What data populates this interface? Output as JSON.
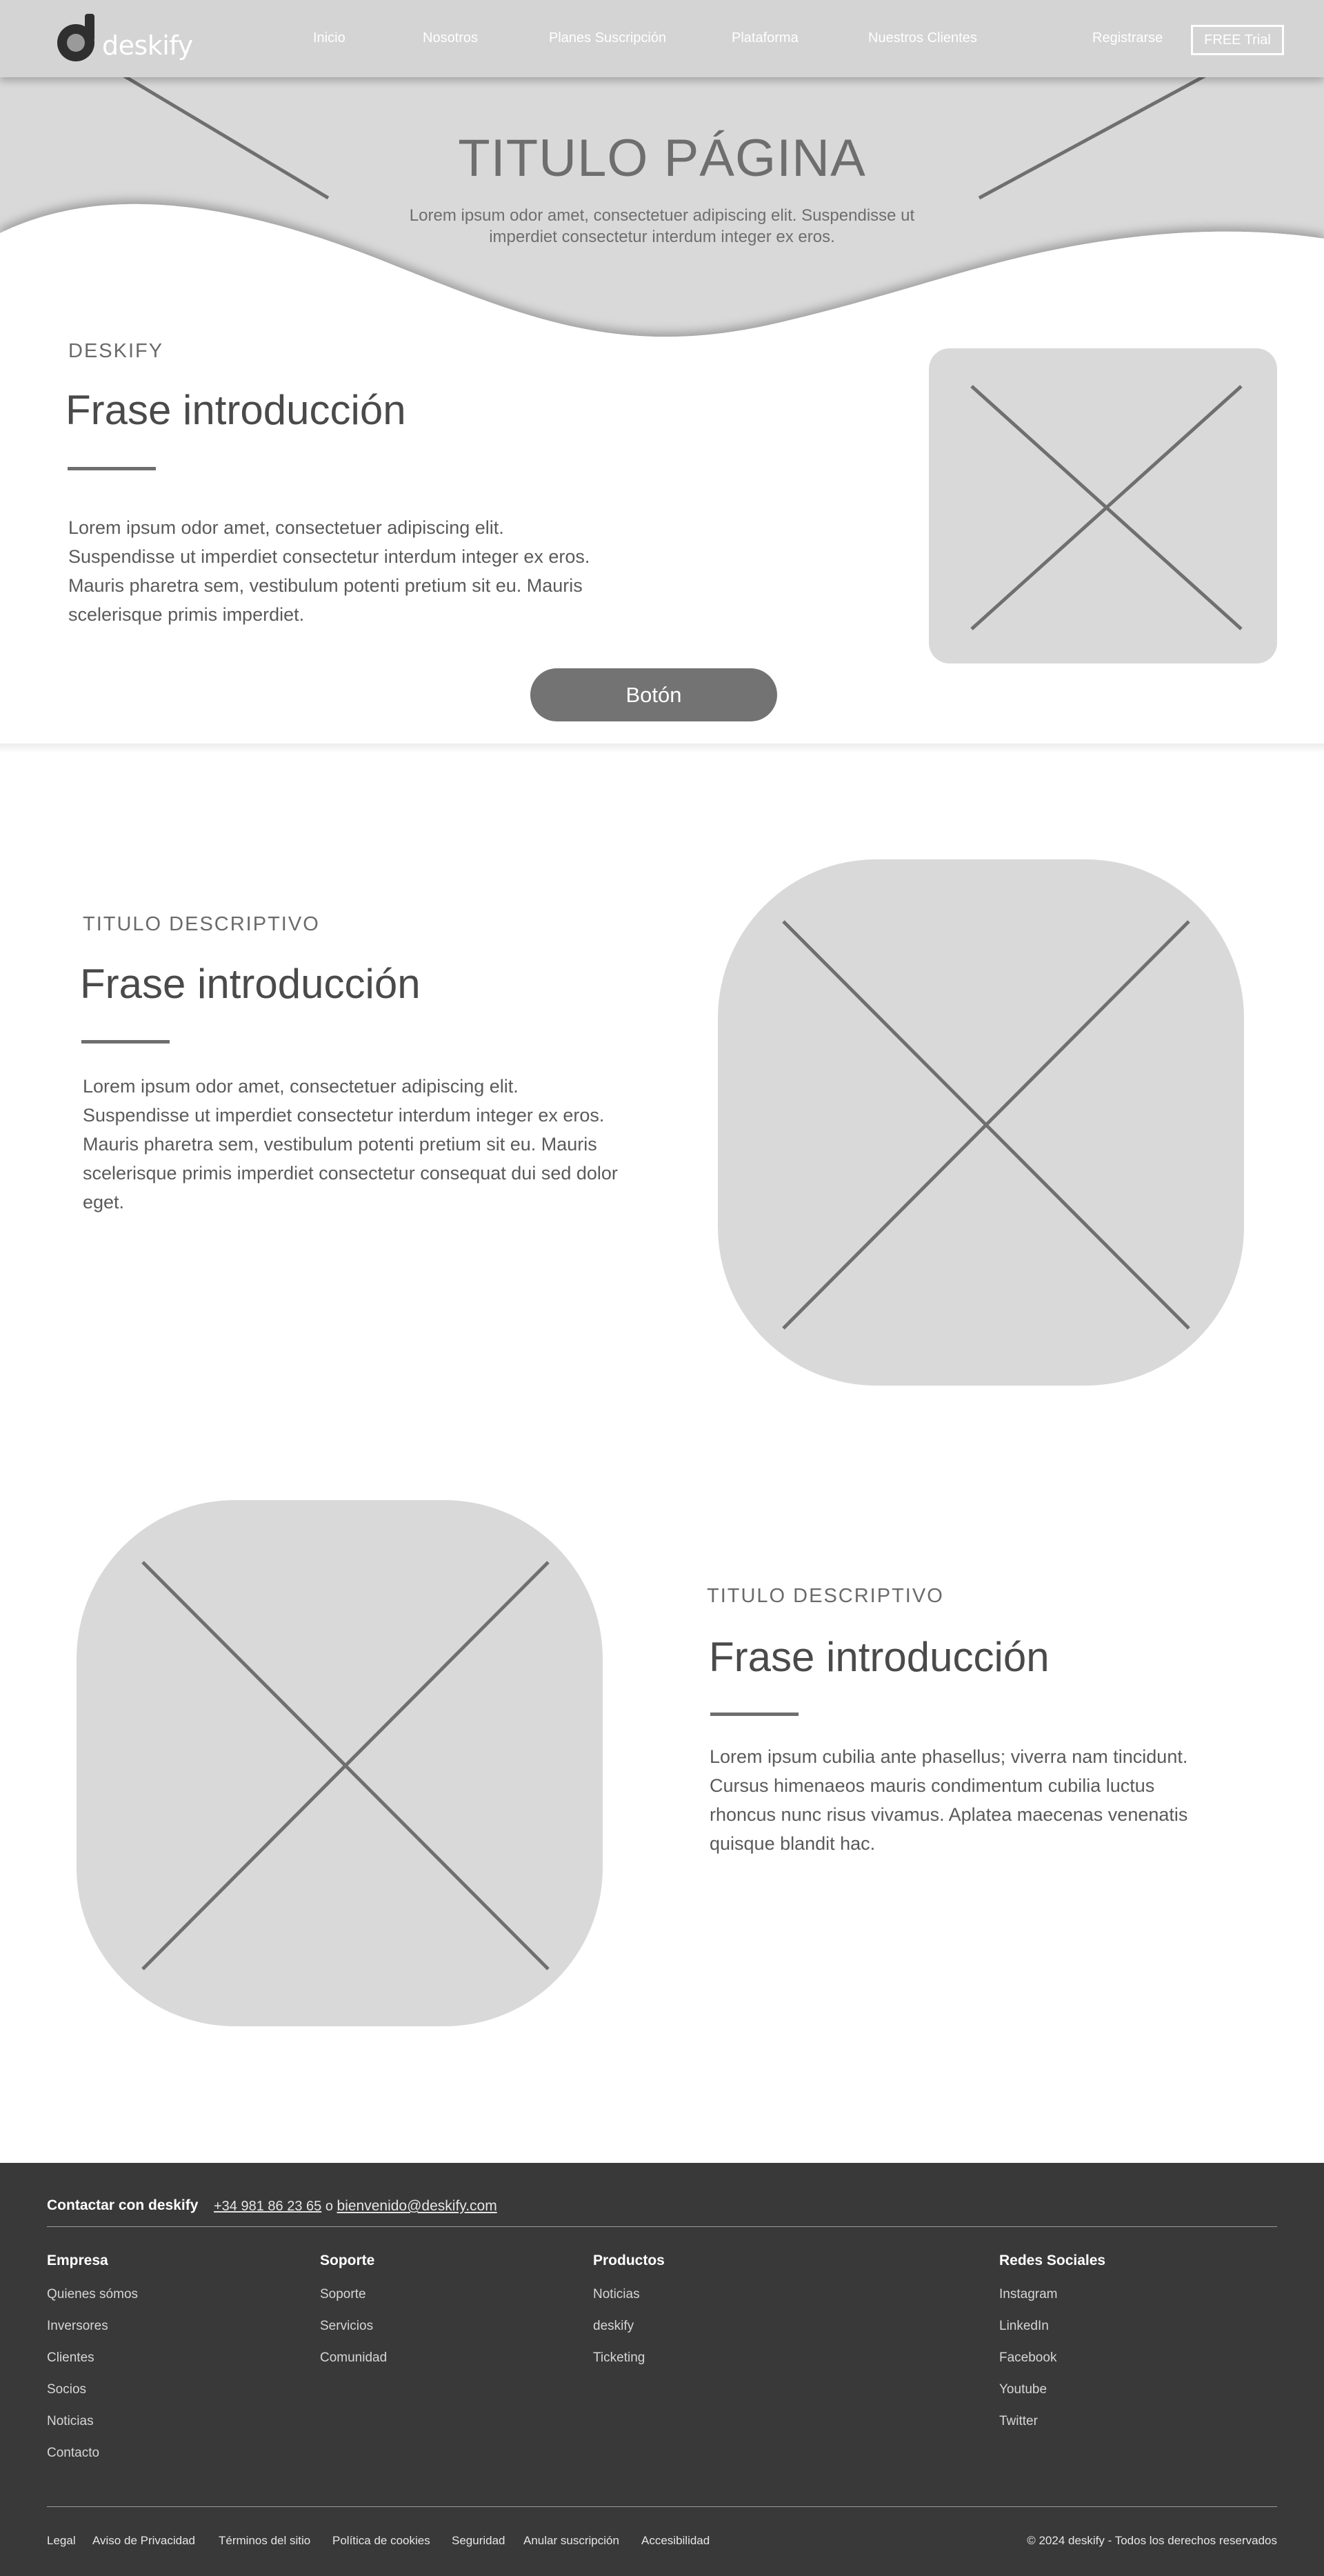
{
  "brand": {
    "name": "deskify"
  },
  "nav": {
    "items": [
      "Inicio",
      "Nosotros",
      "Planes Suscripción",
      "Plataforma",
      "Nuestros Clientes"
    ],
    "register": "Registrarse",
    "trial": "FREE Trial"
  },
  "hero": {
    "title": "TITULO PÁGINA",
    "subtitle": "Lorem ipsum odor amet, consectetuer adipiscing elit. Suspendisse ut imperdiet consectetur interdum integer ex eros."
  },
  "section1": {
    "eyebrow": "DESKIFY",
    "heading": "Frase introducción",
    "body": "Lorem ipsum odor amet, consectetuer adipiscing elit. Suspendisse ut imperdiet consectetur interdum integer ex eros. Mauris pharetra sem, vestibulum potenti pretium sit eu. Mauris scelerisque primis imperdiet.",
    "button": "Botón"
  },
  "section2": {
    "eyebrow": "TITULO DESCRIPTIVO",
    "heading": "Frase introducción",
    "body": "Lorem ipsum odor amet, consectetuer adipiscing elit. Suspendisse ut imperdiet consectetur interdum integer ex eros. Mauris pharetra sem, vestibulum potenti pretium sit eu. Mauris scelerisque primis imperdiet consectetur consequat dui sed dolor eget."
  },
  "section3": {
    "eyebrow": "TITULO DESCRIPTIVO",
    "heading": "Frase introducción",
    "body": "Lorem ipsum cubilia ante phasellus; viverra nam tincidunt. Cursus himenaeos mauris condimentum cubilia luctus rhoncus nunc risus vivamus. Aplatea maecenas venenatis quisque blandit hac."
  },
  "footer": {
    "contact_label": "Contactar con deskify",
    "phone": "+34 981 86 23 65",
    "or": "o",
    "email": "bienvenido@deskify.com",
    "columns": [
      {
        "title": "Empresa",
        "links": [
          "Quienes sómos",
          "Inversores",
          "Clientes",
          "Socios",
          "Noticias",
          "Contacto"
        ]
      },
      {
        "title": "Soporte",
        "links": [
          "Soporte",
          "Servicios",
          "Comunidad"
        ]
      },
      {
        "title": "Productos",
        "links": [
          "Noticias",
          "deskify",
          "Ticketing"
        ]
      },
      {
        "title": "Redes Sociales",
        "links": [
          "Instagram",
          "LinkedIn",
          "Facebook",
          "Youtube",
          "Twitter"
        ]
      }
    ],
    "legal": [
      "Legal",
      "Aviso de Privacidad",
      "Términos del sitio",
      "Política de cookies",
      "Seguridad",
      "Anular suscripción",
      "Accesibilidad"
    ],
    "copyright": "© 2024 deskify - Todos los derechos reservados"
  },
  "colors": {
    "placeholder": "#d9d9d9",
    "accent": "#737373",
    "footer_bg": "#393939"
  }
}
